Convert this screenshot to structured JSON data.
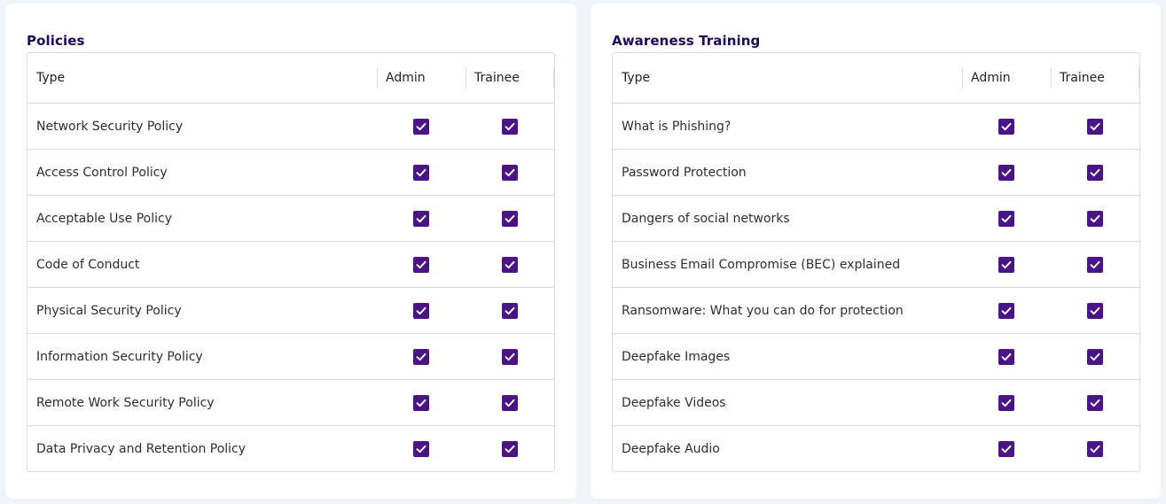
{
  "policies": {
    "title": "Policies",
    "headers": {
      "type": "Type",
      "admin": "Admin",
      "trainee": "Trainee"
    },
    "rows": [
      {
        "label": "Network Security Policy",
        "admin": true,
        "trainee": true
      },
      {
        "label": "Access Control Policy",
        "admin": true,
        "trainee": true
      },
      {
        "label": "Acceptable Use Policy",
        "admin": true,
        "trainee": true
      },
      {
        "label": "Code of Conduct",
        "admin": true,
        "trainee": true
      },
      {
        "label": "Physical Security Policy",
        "admin": true,
        "trainee": true
      },
      {
        "label": "Information Security Policy",
        "admin": true,
        "trainee": true
      },
      {
        "label": "Remote Work Security Policy",
        "admin": true,
        "trainee": true
      },
      {
        "label": "Data Privacy and Retention Policy",
        "admin": true,
        "trainee": true
      }
    ]
  },
  "training": {
    "title": "Awareness Training",
    "headers": {
      "type": "Type",
      "admin": "Admin",
      "trainee": "Trainee"
    },
    "rows": [
      {
        "label": "What is Phishing?",
        "admin": true,
        "trainee": true
      },
      {
        "label": "Password Protection",
        "admin": true,
        "trainee": true
      },
      {
        "label": "Dangers of social networks",
        "admin": true,
        "trainee": true
      },
      {
        "label": "Business Email Compromise (BEC) explained",
        "admin": true,
        "trainee": true
      },
      {
        "label": "Ransomware: What you can do for protection",
        "admin": true,
        "trainee": true
      },
      {
        "label": "Deepfake Images",
        "admin": true,
        "trainee": true
      },
      {
        "label": "Deepfake Videos",
        "admin": true,
        "trainee": true
      },
      {
        "label": "Deepfake Audio",
        "admin": true,
        "trainee": true
      }
    ]
  },
  "colors": {
    "accent": "#4a1386",
    "title": "#1d0a5c"
  },
  "icons": {
    "checked": "checkbox-checked-icon"
  }
}
